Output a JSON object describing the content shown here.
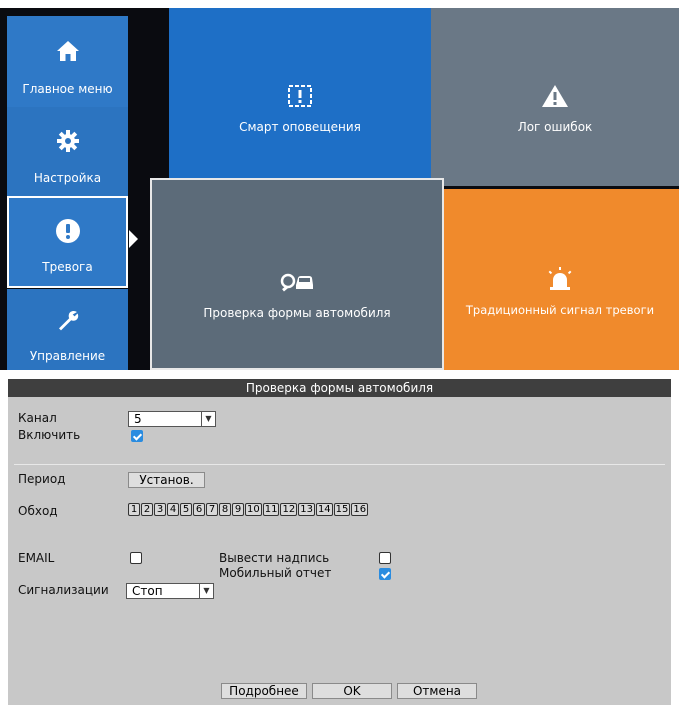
{
  "menu": {
    "sidebar": [
      {
        "label": "Главное меню",
        "icon": "home-icon"
      },
      {
        "label": "Настройка",
        "icon": "gear-icon"
      },
      {
        "label": "Тревога",
        "icon": "alert-icon"
      },
      {
        "label": "Управление",
        "icon": "wrench-icon"
      }
    ],
    "tiles": {
      "smart": {
        "label": "Смарт оповещения",
        "icon": "smart-alert-icon"
      },
      "log": {
        "label": "Лог ошибок",
        "icon": "warning-triangle-icon"
      },
      "car": {
        "label": "Проверка формы автомобиля",
        "icon": "car-search-icon"
      },
      "classic": {
        "label": "Традиционный сигнал тревоги",
        "icon": "siren-icon"
      }
    },
    "colors": {
      "blue": "#1e6fc6",
      "gray": "#6a7886",
      "orange": "#f08a2c",
      "slate": "#5c6b79"
    }
  },
  "dialog": {
    "title": "Проверка формы автомобиля",
    "channel": {
      "label": "Канал",
      "value": "5"
    },
    "enable": {
      "label": "Включить",
      "checked": true
    },
    "period": {
      "label": "Период",
      "button": "Установ."
    },
    "cruise": {
      "label": "Обход",
      "items": [
        "1",
        "2",
        "3",
        "4",
        "5",
        "6",
        "7",
        "8",
        "9",
        "10",
        "11",
        "12",
        "13",
        "14",
        "15",
        "16"
      ]
    },
    "email": {
      "label": "EMAIL",
      "checked": false
    },
    "show_text": {
      "label": "Вывести надпись",
      "checked": false
    },
    "mobile_report": {
      "label": "Мобильный отчет",
      "checked": true
    },
    "alarm": {
      "label": "Сигнализации",
      "value": "Стоп"
    },
    "buttons": {
      "details": "Подробнее",
      "ok": "OK",
      "cancel": "Отмена"
    }
  }
}
